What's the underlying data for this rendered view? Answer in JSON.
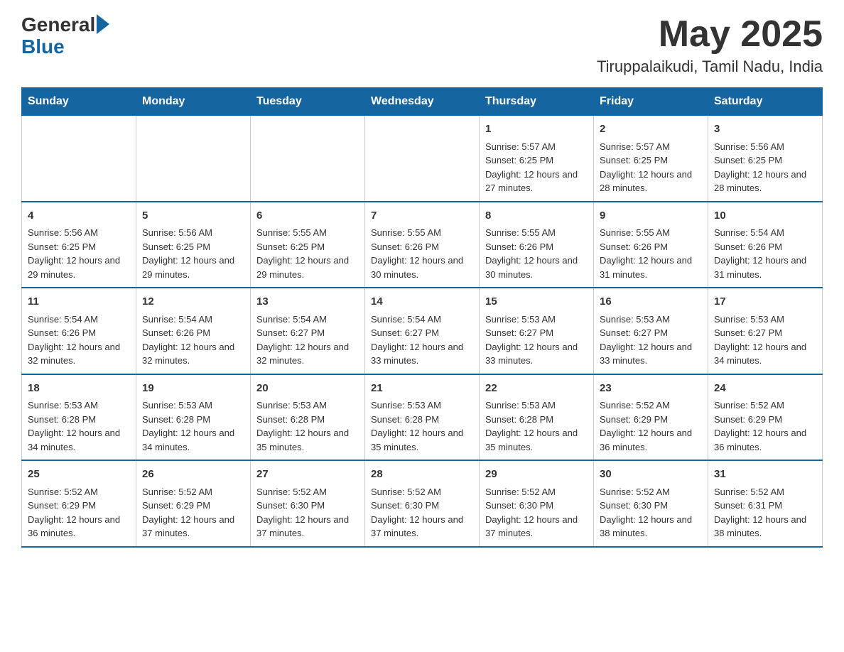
{
  "header": {
    "logo_general": "General",
    "logo_blue": "Blue",
    "month_title": "May 2025",
    "location": "Tiruppalaikudi, Tamil Nadu, India"
  },
  "days_of_week": [
    "Sunday",
    "Monday",
    "Tuesday",
    "Wednesday",
    "Thursday",
    "Friday",
    "Saturday"
  ],
  "weeks": [
    [
      {
        "day": "",
        "info": ""
      },
      {
        "day": "",
        "info": ""
      },
      {
        "day": "",
        "info": ""
      },
      {
        "day": "",
        "info": ""
      },
      {
        "day": "1",
        "info": "Sunrise: 5:57 AM\nSunset: 6:25 PM\nDaylight: 12 hours and 27 minutes."
      },
      {
        "day": "2",
        "info": "Sunrise: 5:57 AM\nSunset: 6:25 PM\nDaylight: 12 hours and 28 minutes."
      },
      {
        "day": "3",
        "info": "Sunrise: 5:56 AM\nSunset: 6:25 PM\nDaylight: 12 hours and 28 minutes."
      }
    ],
    [
      {
        "day": "4",
        "info": "Sunrise: 5:56 AM\nSunset: 6:25 PM\nDaylight: 12 hours and 29 minutes."
      },
      {
        "day": "5",
        "info": "Sunrise: 5:56 AM\nSunset: 6:25 PM\nDaylight: 12 hours and 29 minutes."
      },
      {
        "day": "6",
        "info": "Sunrise: 5:55 AM\nSunset: 6:25 PM\nDaylight: 12 hours and 29 minutes."
      },
      {
        "day": "7",
        "info": "Sunrise: 5:55 AM\nSunset: 6:26 PM\nDaylight: 12 hours and 30 minutes."
      },
      {
        "day": "8",
        "info": "Sunrise: 5:55 AM\nSunset: 6:26 PM\nDaylight: 12 hours and 30 minutes."
      },
      {
        "day": "9",
        "info": "Sunrise: 5:55 AM\nSunset: 6:26 PM\nDaylight: 12 hours and 31 minutes."
      },
      {
        "day": "10",
        "info": "Sunrise: 5:54 AM\nSunset: 6:26 PM\nDaylight: 12 hours and 31 minutes."
      }
    ],
    [
      {
        "day": "11",
        "info": "Sunrise: 5:54 AM\nSunset: 6:26 PM\nDaylight: 12 hours and 32 minutes."
      },
      {
        "day": "12",
        "info": "Sunrise: 5:54 AM\nSunset: 6:26 PM\nDaylight: 12 hours and 32 minutes."
      },
      {
        "day": "13",
        "info": "Sunrise: 5:54 AM\nSunset: 6:27 PM\nDaylight: 12 hours and 32 minutes."
      },
      {
        "day": "14",
        "info": "Sunrise: 5:54 AM\nSunset: 6:27 PM\nDaylight: 12 hours and 33 minutes."
      },
      {
        "day": "15",
        "info": "Sunrise: 5:53 AM\nSunset: 6:27 PM\nDaylight: 12 hours and 33 minutes."
      },
      {
        "day": "16",
        "info": "Sunrise: 5:53 AM\nSunset: 6:27 PM\nDaylight: 12 hours and 33 minutes."
      },
      {
        "day": "17",
        "info": "Sunrise: 5:53 AM\nSunset: 6:27 PM\nDaylight: 12 hours and 34 minutes."
      }
    ],
    [
      {
        "day": "18",
        "info": "Sunrise: 5:53 AM\nSunset: 6:28 PM\nDaylight: 12 hours and 34 minutes."
      },
      {
        "day": "19",
        "info": "Sunrise: 5:53 AM\nSunset: 6:28 PM\nDaylight: 12 hours and 34 minutes."
      },
      {
        "day": "20",
        "info": "Sunrise: 5:53 AM\nSunset: 6:28 PM\nDaylight: 12 hours and 35 minutes."
      },
      {
        "day": "21",
        "info": "Sunrise: 5:53 AM\nSunset: 6:28 PM\nDaylight: 12 hours and 35 minutes."
      },
      {
        "day": "22",
        "info": "Sunrise: 5:53 AM\nSunset: 6:28 PM\nDaylight: 12 hours and 35 minutes."
      },
      {
        "day": "23",
        "info": "Sunrise: 5:52 AM\nSunset: 6:29 PM\nDaylight: 12 hours and 36 minutes."
      },
      {
        "day": "24",
        "info": "Sunrise: 5:52 AM\nSunset: 6:29 PM\nDaylight: 12 hours and 36 minutes."
      }
    ],
    [
      {
        "day": "25",
        "info": "Sunrise: 5:52 AM\nSunset: 6:29 PM\nDaylight: 12 hours and 36 minutes."
      },
      {
        "day": "26",
        "info": "Sunrise: 5:52 AM\nSunset: 6:29 PM\nDaylight: 12 hours and 37 minutes."
      },
      {
        "day": "27",
        "info": "Sunrise: 5:52 AM\nSunset: 6:30 PM\nDaylight: 12 hours and 37 minutes."
      },
      {
        "day": "28",
        "info": "Sunrise: 5:52 AM\nSunset: 6:30 PM\nDaylight: 12 hours and 37 minutes."
      },
      {
        "day": "29",
        "info": "Sunrise: 5:52 AM\nSunset: 6:30 PM\nDaylight: 12 hours and 37 minutes."
      },
      {
        "day": "30",
        "info": "Sunrise: 5:52 AM\nSunset: 6:30 PM\nDaylight: 12 hours and 38 minutes."
      },
      {
        "day": "31",
        "info": "Sunrise: 5:52 AM\nSunset: 6:31 PM\nDaylight: 12 hours and 38 minutes."
      }
    ]
  ]
}
